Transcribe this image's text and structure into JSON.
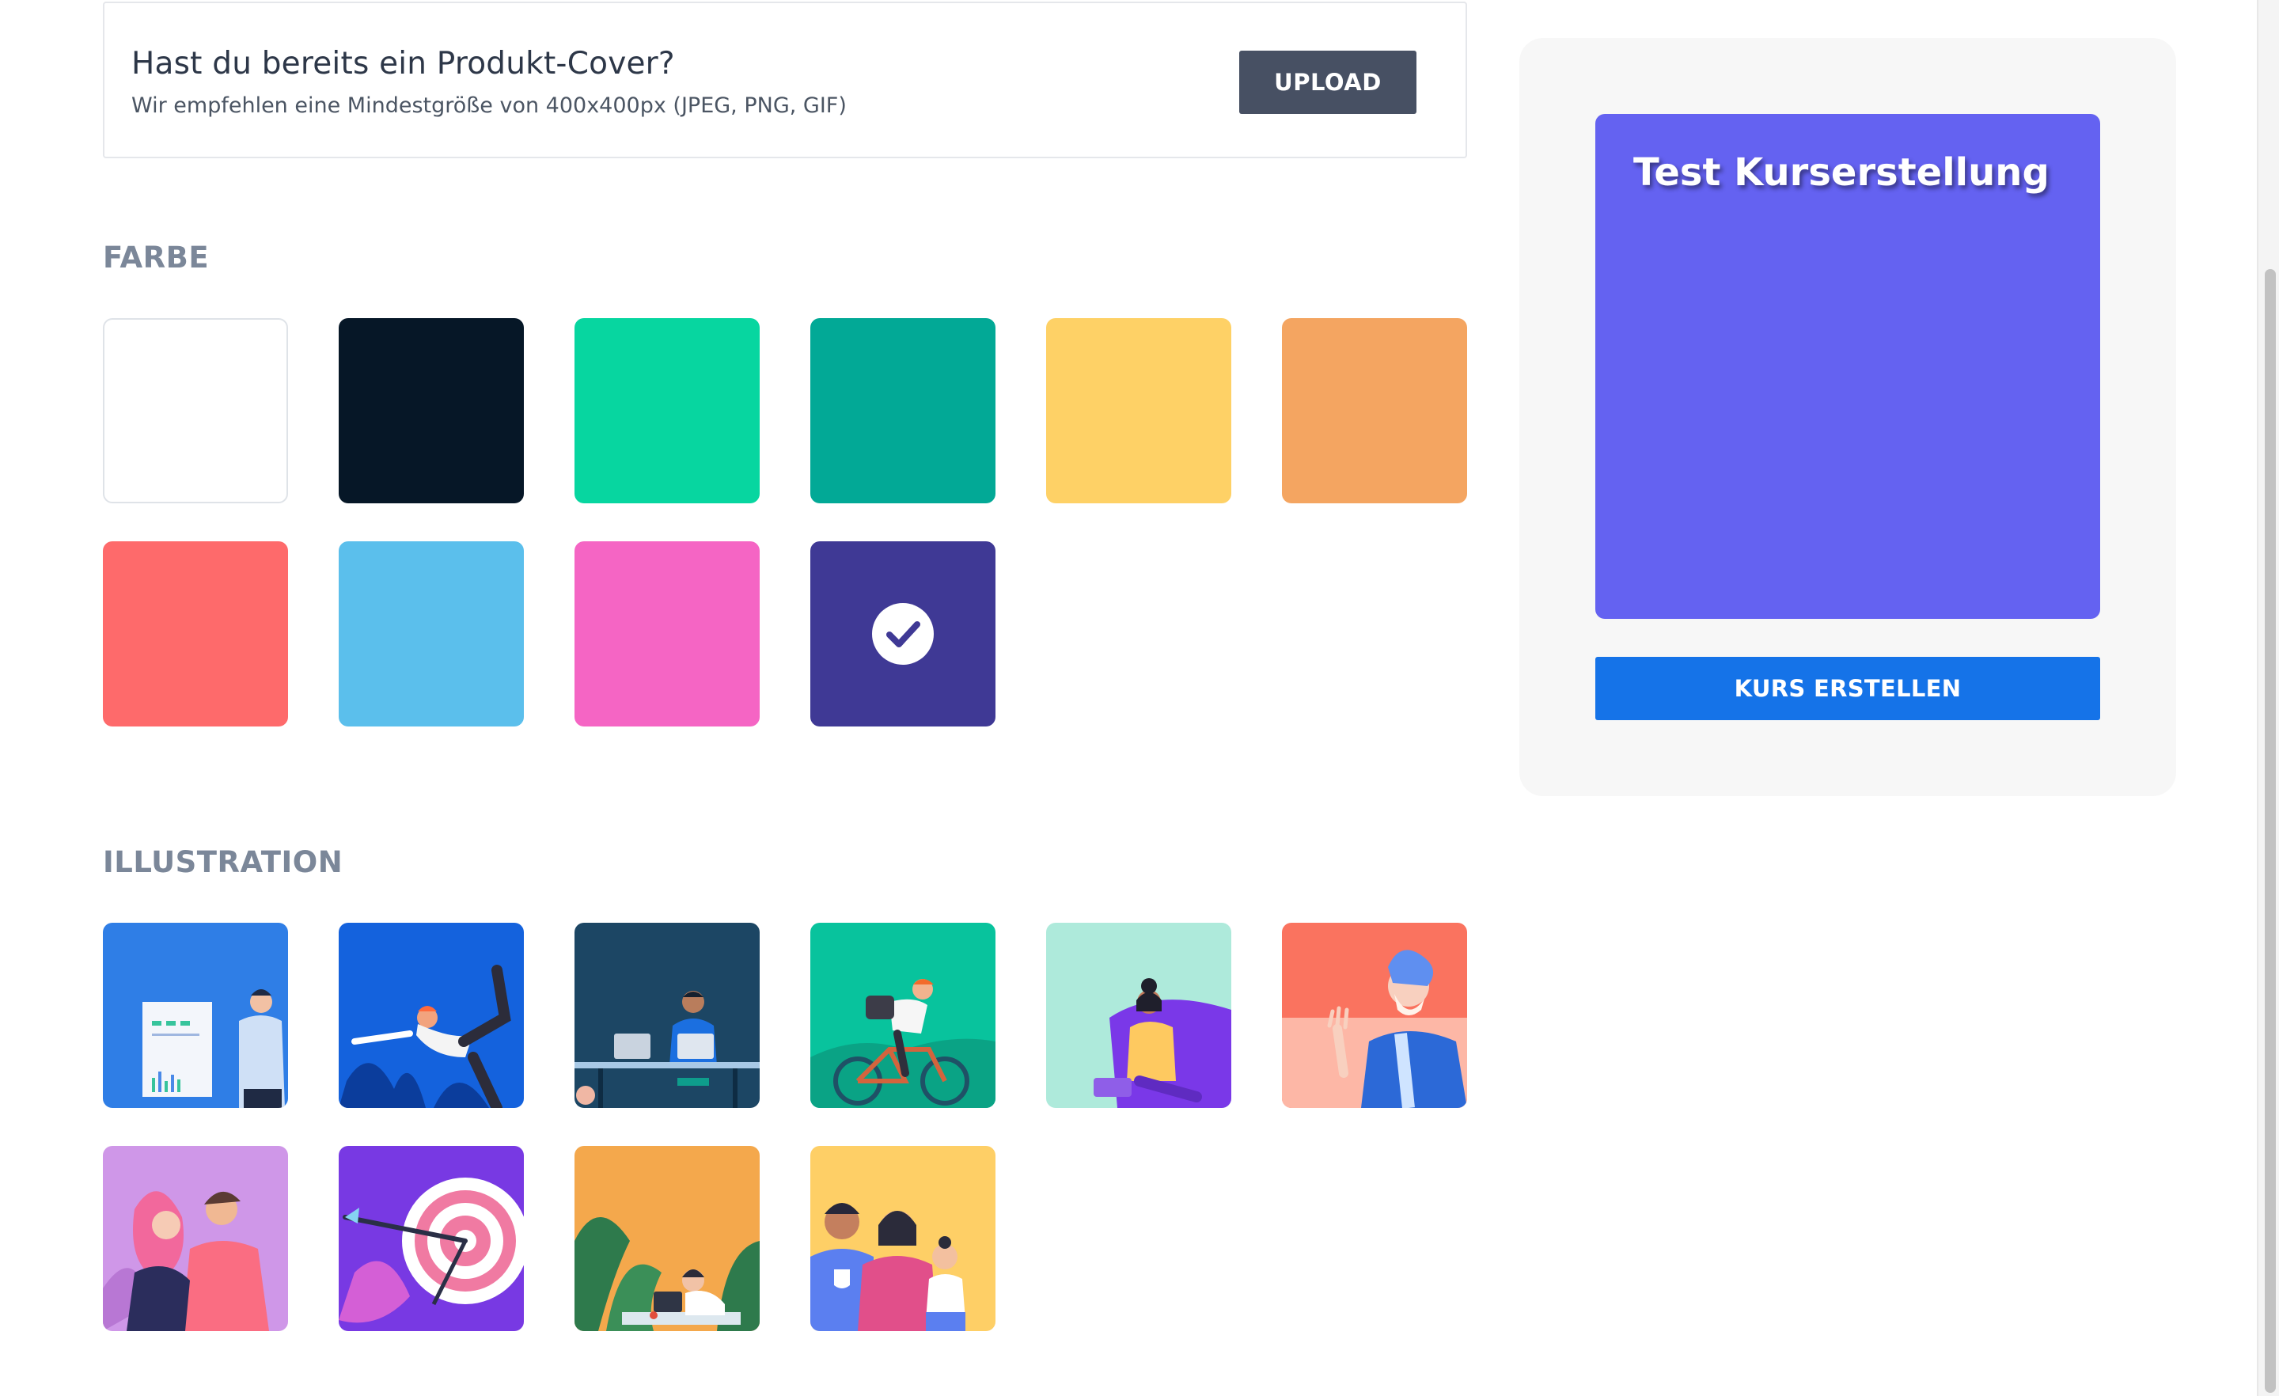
{
  "upload": {
    "title": "Hast du bereits ein Produkt-Cover?",
    "subtitle": "Wir empfehlen eine Mindestgröße von 400x400px (JPEG, PNG, GIF)",
    "button_label": "UPLOAD"
  },
  "color_section": {
    "heading": "FARBE",
    "selected_index": 9,
    "swatches": [
      {
        "name": "white",
        "hex": "#ffffff"
      },
      {
        "name": "navy",
        "hex": "#061727"
      },
      {
        "name": "mint",
        "hex": "#07d6a0"
      },
      {
        "name": "teal",
        "hex": "#02a996"
      },
      {
        "name": "yellow",
        "hex": "#fed166"
      },
      {
        "name": "orange",
        "hex": "#f4a561"
      },
      {
        "name": "coral",
        "hex": "#fe6a6b"
      },
      {
        "name": "sky",
        "hex": "#5bbfec"
      },
      {
        "name": "pink",
        "hex": "#f565c4"
      },
      {
        "name": "indigo",
        "hex": "#3f3995"
      }
    ]
  },
  "illustration_section": {
    "heading": "ILLUSTRATION",
    "items": [
      {
        "name": "presentation",
        "bg": "#2f7ee6"
      },
      {
        "name": "yoga",
        "bg": "#1462dd"
      },
      {
        "name": "desk-work",
        "bg": "#1c4664"
      },
      {
        "name": "cyclist",
        "bg": "#08c39d"
      },
      {
        "name": "laptop-chair",
        "bg": "#aeeadb"
      },
      {
        "name": "waving-man",
        "bg": "#fa735f"
      },
      {
        "name": "couple",
        "bg": "#cf97e8"
      },
      {
        "name": "target",
        "bg": "#7839e3"
      },
      {
        "name": "jungle-laptop",
        "bg": "#f4a84c"
      },
      {
        "name": "family",
        "bg": "#fecf66"
      }
    ]
  },
  "preview": {
    "cover_title": "Test Kurserstellung",
    "cover_color": "#6462f1",
    "button_label": "KURS ERSTELLEN"
  },
  "colors": {
    "primary_button": "#1573e8",
    "upload_button": "#475063",
    "heading": "#7b8799"
  }
}
